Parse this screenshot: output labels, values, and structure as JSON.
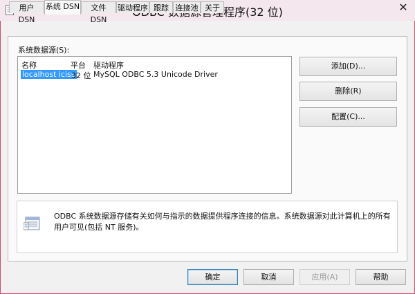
{
  "window": {
    "title": "ODBC 数据源管理程序(32 位)",
    "close_glyph": "✕"
  },
  "tabs": [
    {
      "label": "用户 DSN"
    },
    {
      "label": "系统 DSN"
    },
    {
      "label": "文件 DSN"
    },
    {
      "label": "驱动程序"
    },
    {
      "label": "跟踪"
    },
    {
      "label": "连接池"
    },
    {
      "label": "关于"
    }
  ],
  "active_tab": "系统 DSN",
  "section_label": "系统数据源(S):",
  "list": {
    "columns": [
      "名称",
      "平台",
      "驱动程序"
    ],
    "rows": [
      {
        "name": "localhost iciss",
        "platform": "32 位",
        "driver": "MySQL ODBC 5.3 Unicode Driver",
        "selected": true
      }
    ]
  },
  "side_buttons": {
    "add": "添加(D)...",
    "remove": "删除(R)",
    "configure": "配置(C)..."
  },
  "info": {
    "icon": "data-source-icon",
    "text": "ODBC 系统数据源存储有关如何与指示的数据提供程序连接的信息。系统数据源对此计算机上的所有用户可见(包括 NT 服务)。"
  },
  "dialog_buttons": {
    "ok": "确定",
    "cancel": "取消",
    "apply": "应用(A)",
    "help": "帮助"
  },
  "colors": {
    "title_bar": "#f4e7ee",
    "window_border": "#d24a6a",
    "selection": "#3399ff"
  }
}
